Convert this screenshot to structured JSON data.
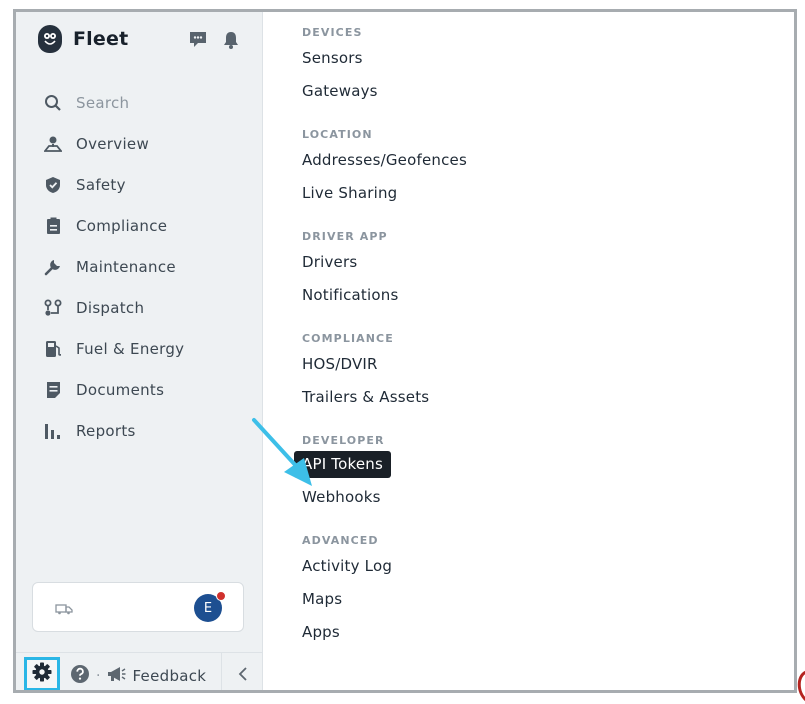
{
  "app": {
    "name": "Fleet"
  },
  "sidebar": {
    "top_icons": [
      "chat-icon",
      "bell-icon"
    ],
    "items": [
      {
        "label": "Search",
        "icon": "search-icon"
      },
      {
        "label": "Overview",
        "icon": "map-pin-icon"
      },
      {
        "label": "Safety",
        "icon": "shield-icon"
      },
      {
        "label": "Compliance",
        "icon": "clipboard-icon"
      },
      {
        "label": "Maintenance",
        "icon": "wrench-icon"
      },
      {
        "label": "Dispatch",
        "icon": "route-icon"
      },
      {
        "label": "Fuel & Energy",
        "icon": "fuel-icon"
      },
      {
        "label": "Documents",
        "icon": "document-icon"
      },
      {
        "label": "Reports",
        "icon": "bar-chart-icon"
      }
    ],
    "avatar_initial": "E",
    "footer": {
      "feedback_label": "Feedback",
      "separator": "·"
    }
  },
  "menu": {
    "sections": [
      {
        "header": "DEVICES",
        "items": [
          "Sensors",
          "Gateways"
        ]
      },
      {
        "header": "LOCATION",
        "items": [
          "Addresses/Geofences",
          "Live Sharing"
        ]
      },
      {
        "header": "DRIVER APP",
        "items": [
          "Drivers",
          "Notifications"
        ]
      },
      {
        "header": "COMPLIANCE",
        "items": [
          "HOS/DVIR",
          "Trailers & Assets"
        ]
      },
      {
        "header": "DEVELOPER",
        "items": [
          "API Tokens",
          "Webhooks"
        ]
      },
      {
        "header": "ADVANCED",
        "items": [
          "Activity Log",
          "Maps",
          "Apps"
        ]
      }
    ],
    "active_item": "API Tokens"
  },
  "colors": {
    "sidebar_bg": "#eef1f3",
    "highlight_border": "#2ab6e6",
    "arrow": "#3dbfe8",
    "active_bg": "#1a2027",
    "avatar_bg": "#1d4f91",
    "notification_dot": "#d0312d"
  }
}
